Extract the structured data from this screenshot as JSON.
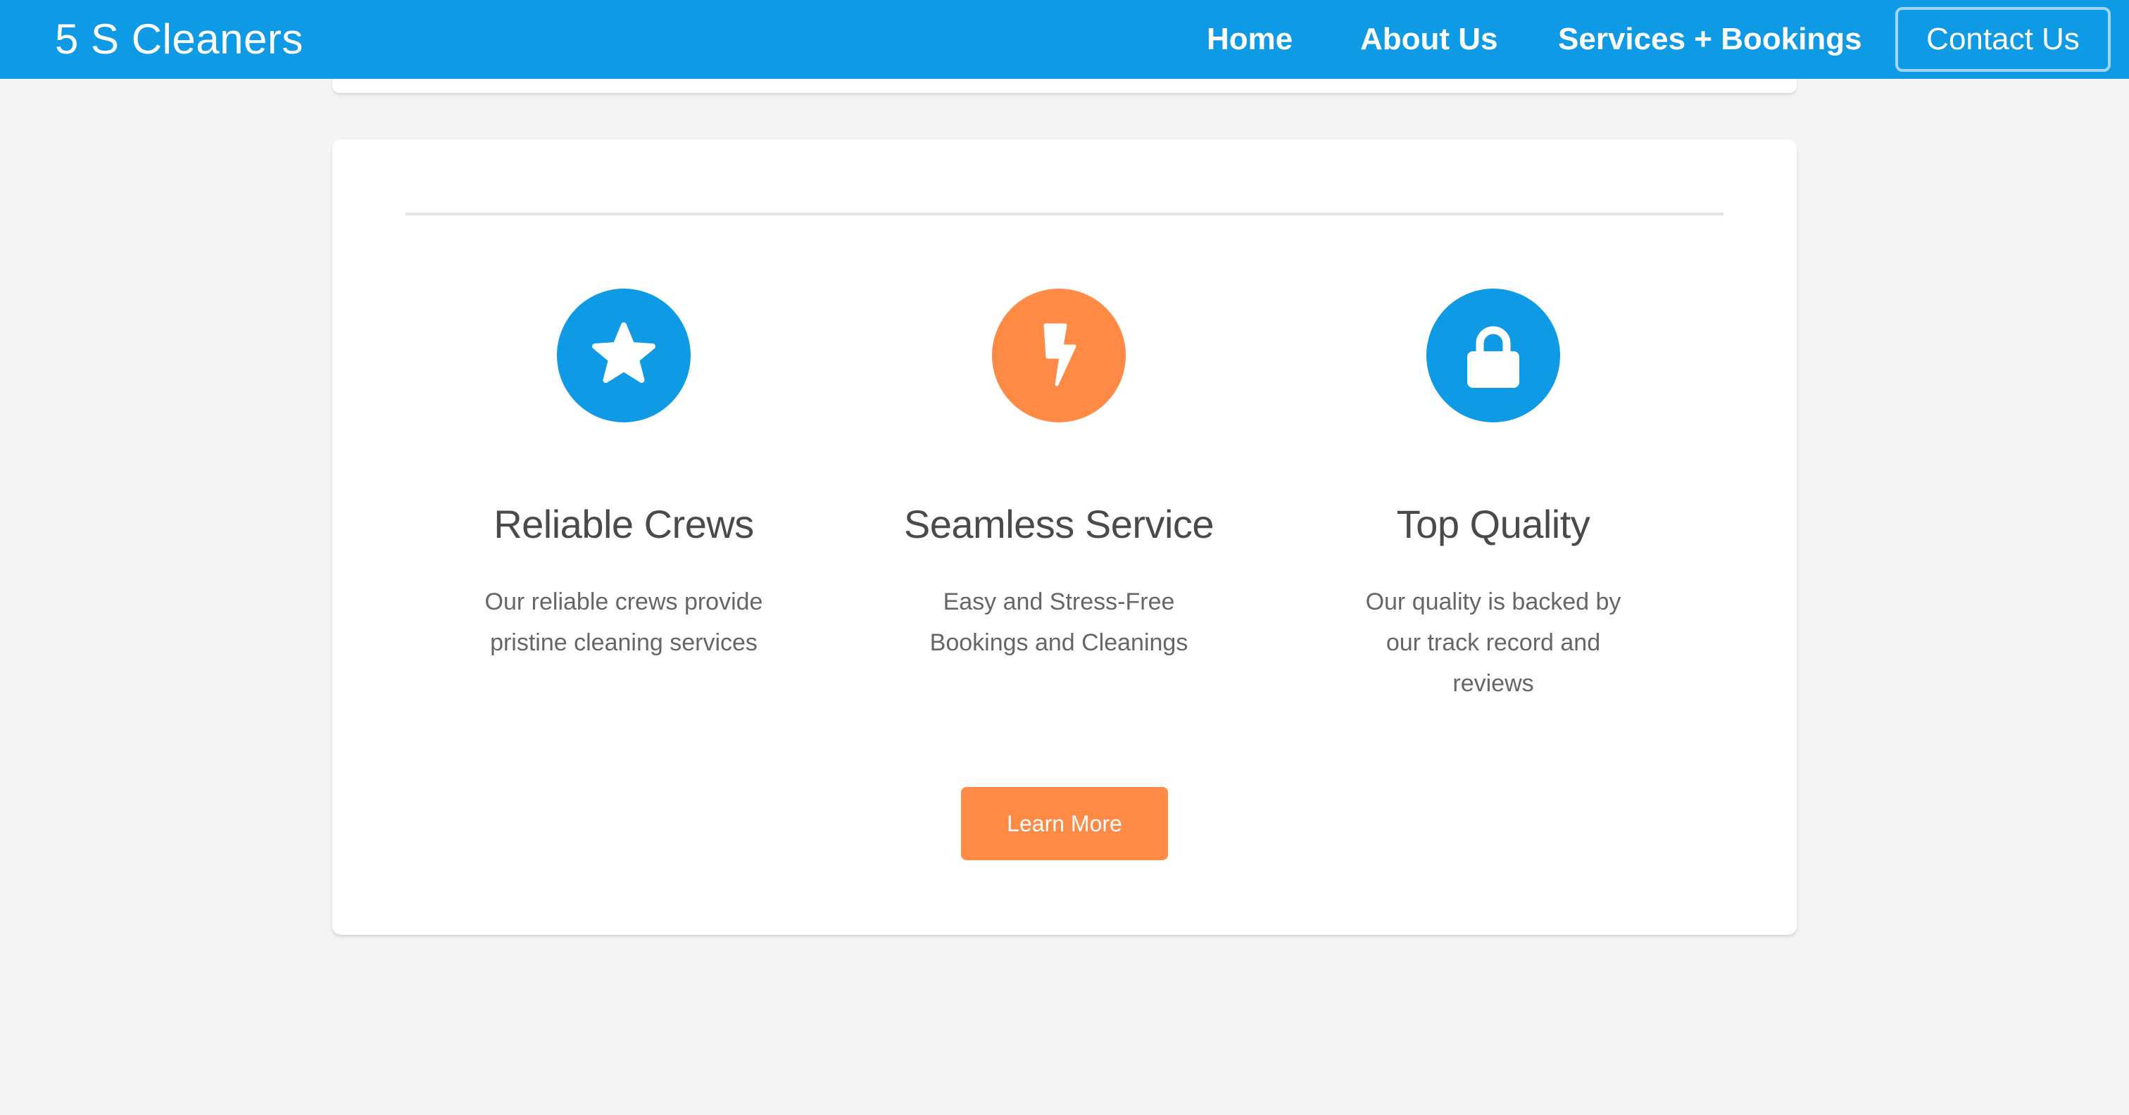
{
  "header": {
    "brand": "5 S Cleaners",
    "nav": {
      "home": "Home",
      "about": "About Us",
      "services": "Services + Bookings",
      "contact": "Contact Us"
    },
    "color": "#0f9ae6"
  },
  "features": [
    {
      "icon": "star-icon",
      "color": "#0f9ae6",
      "title": "Reliable Crews",
      "description": "Our reliable crews provide pristine cleaning services"
    },
    {
      "icon": "lightning-bolt-icon",
      "color": "#ff8a45",
      "title": "Seamless Service",
      "description": "Easy and Stress-Free Bookings and Cleanings"
    },
    {
      "icon": "lock-icon",
      "color": "#0f9ae6",
      "title": "Top Quality",
      "description": "Our quality is backed by our track record and reviews"
    }
  ],
  "cta": {
    "label": "Learn More",
    "color": "#ff8a45"
  }
}
